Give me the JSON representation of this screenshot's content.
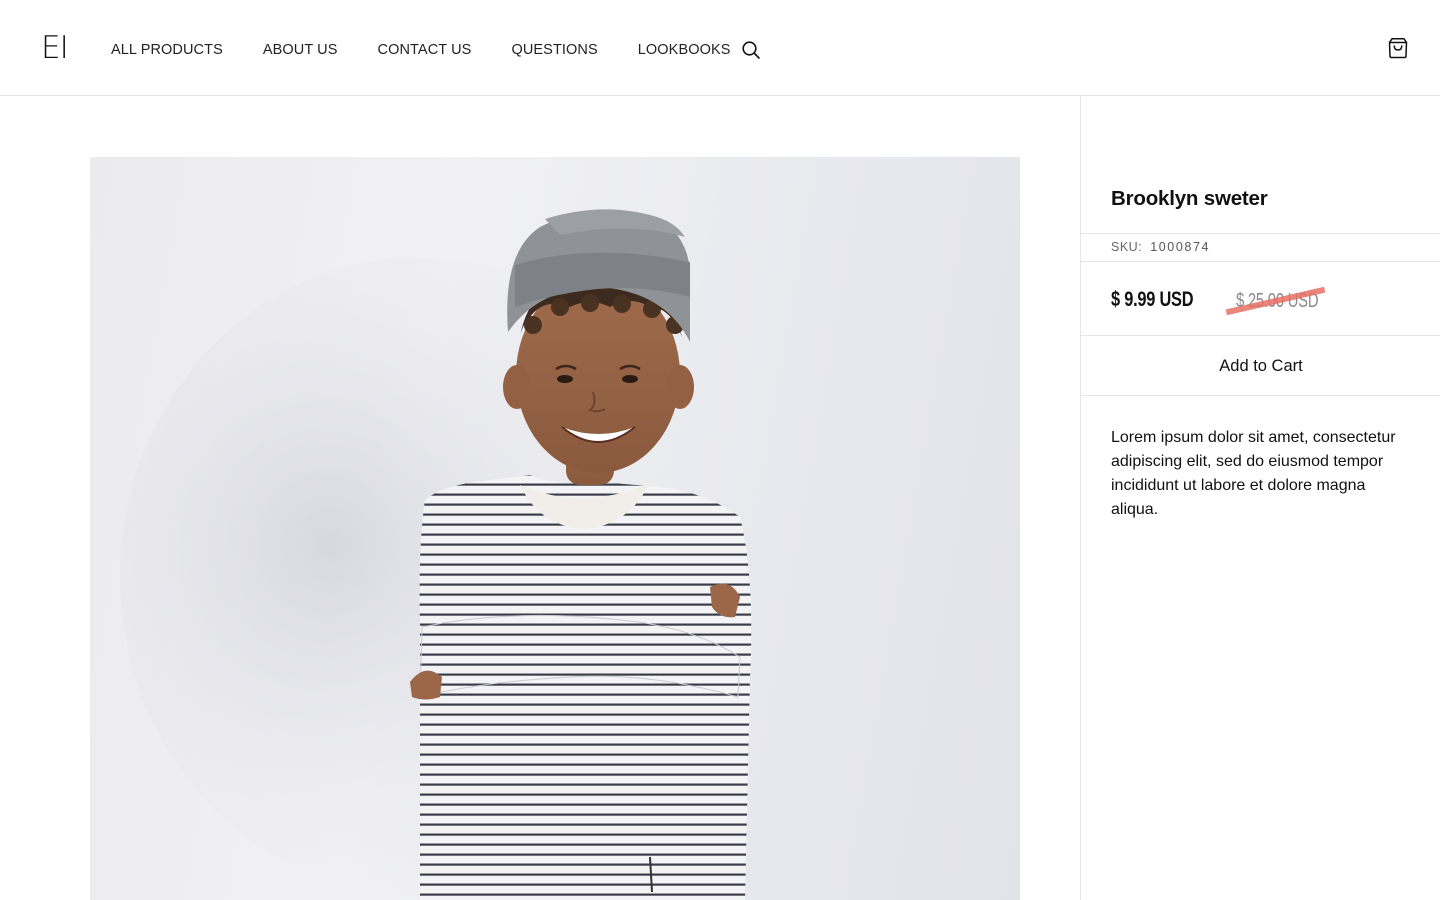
{
  "header": {
    "logo": "EI",
    "nav": [
      {
        "label": "ALL PRODUCTS"
      },
      {
        "label": "ABOUT US"
      },
      {
        "label": "CONTACT US"
      },
      {
        "label": "QUESTIONS"
      },
      {
        "label": "LOOKBOOKS"
      }
    ],
    "search_icon": "search-icon",
    "cart_icon": "shopping-bag-icon"
  },
  "product": {
    "image_subject": "child-in-striped-sweater-and-beanie",
    "title": "Brooklyn sweter",
    "sku_label": "SKU:",
    "sku": "1000874",
    "price": "$ 9.99 USD",
    "compare_price": "$ 25.00 USD",
    "add_to_cart_label": "Add to Cart",
    "description": "Lorem ipsum dolor sit amet, consectetur adipiscing elit, sed do eiusmod tempor incididunt ut labore et dolore magna aliqua."
  },
  "colors": {
    "border": "#e6e6e6",
    "text": "#111111",
    "muted": "#8a8a8a",
    "strike": "#e86f64",
    "image_background": "#ebebef"
  }
}
